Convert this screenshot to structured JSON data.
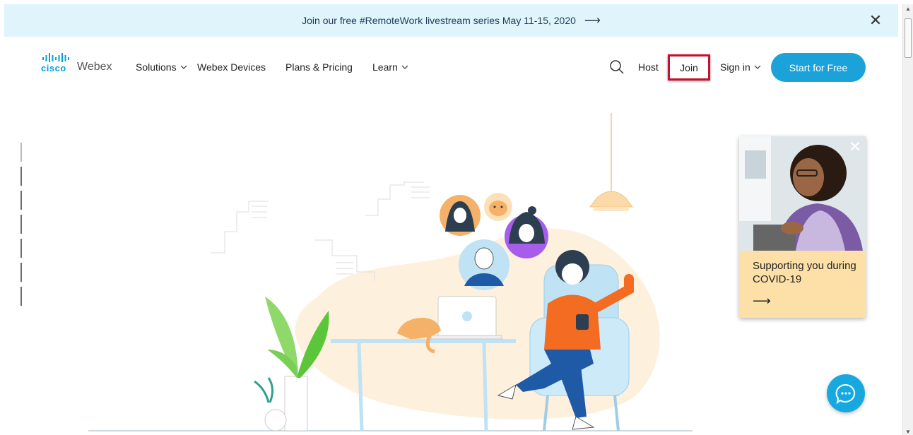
{
  "banner": {
    "text": "Join our free #RemoteWork livestream series May 11-15, 2020",
    "arrow": "⟶",
    "close_icon": "close-icon"
  },
  "logo": {
    "brand": "cisco",
    "product": "Webex"
  },
  "nav": {
    "solutions": "Solutions",
    "webex_devices": "Webex Devices",
    "plans_pricing": "Plans & Pricing",
    "learn": "Learn",
    "host": "Host",
    "join": "Join",
    "sign_in": "Sign in",
    "start_free": "Start for Free"
  },
  "promo": {
    "title": "Supporting you during COVID-19",
    "arrow": "⟶"
  },
  "colors": {
    "accent": "#1ba2d8",
    "banner_bg": "#dff5fb",
    "highlight": "#c8102e",
    "promo_bg": "#fde0a8"
  }
}
